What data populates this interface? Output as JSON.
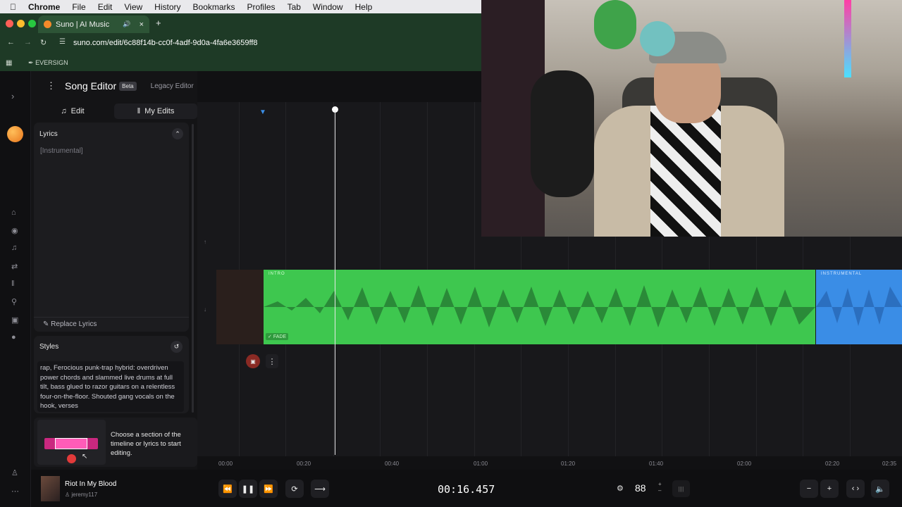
{
  "macmenu": {
    "apple": "",
    "app": "Chrome",
    "items": [
      "File",
      "Edit",
      "View",
      "History",
      "Bookmarks",
      "Profiles",
      "Tab",
      "Window",
      "Help"
    ]
  },
  "browser": {
    "tab_title": "Suno | AI Music",
    "url": "suno.com/edit/6c88f14b-cc0f-4adf-9d0a-4fa6e3659ff8",
    "bookmark": "EVERSIGN"
  },
  "editor": {
    "title": "Song Editor",
    "badge": "Beta",
    "legacy": "Legacy Editor",
    "tab_edit": "Edit",
    "tab_myedits": "My Edits"
  },
  "lyrics": {
    "heading": "Lyrics",
    "placeholder": "[Instrumental]",
    "replace": "Replace Lyrics"
  },
  "styles": {
    "heading": "Styles",
    "text": "rap, Ferocious punk-trap hybrid: overdriven power chords and slammed live drums at full tilt, bass glued to razor guitars on a relentless four-on-the-floor. Shouted gang vocals on the hook, verses"
  },
  "hint": {
    "text": "Choose a section of the timeline or lyrics to start editing."
  },
  "track": {
    "intro": "INTRO",
    "instrumental": "INSTRUMENTAL",
    "fade": "FADE",
    "color_main": "#3ec74f",
    "color_alt": "#3a8de6"
  },
  "ruler": [
    "00:00",
    "00:20",
    "00:40",
    "01:00",
    "01:20",
    "01:40",
    "02:00",
    "02:20",
    "02:35"
  ],
  "song": {
    "title": "Riot In My Blood",
    "artist": "jeremy117"
  },
  "transport": {
    "time": "00:16.457",
    "bpm": "88"
  },
  "icons": {
    "rewind": "rewind-icon",
    "pause": "pause-icon",
    "forward": "fast-forward-icon",
    "loop": "loop-icon",
    "split": "split-icon",
    "metronome": "gear-icon",
    "zoom_out": "minus-icon",
    "zoom_in": "plus-icon",
    "volume": "speaker-icon"
  }
}
